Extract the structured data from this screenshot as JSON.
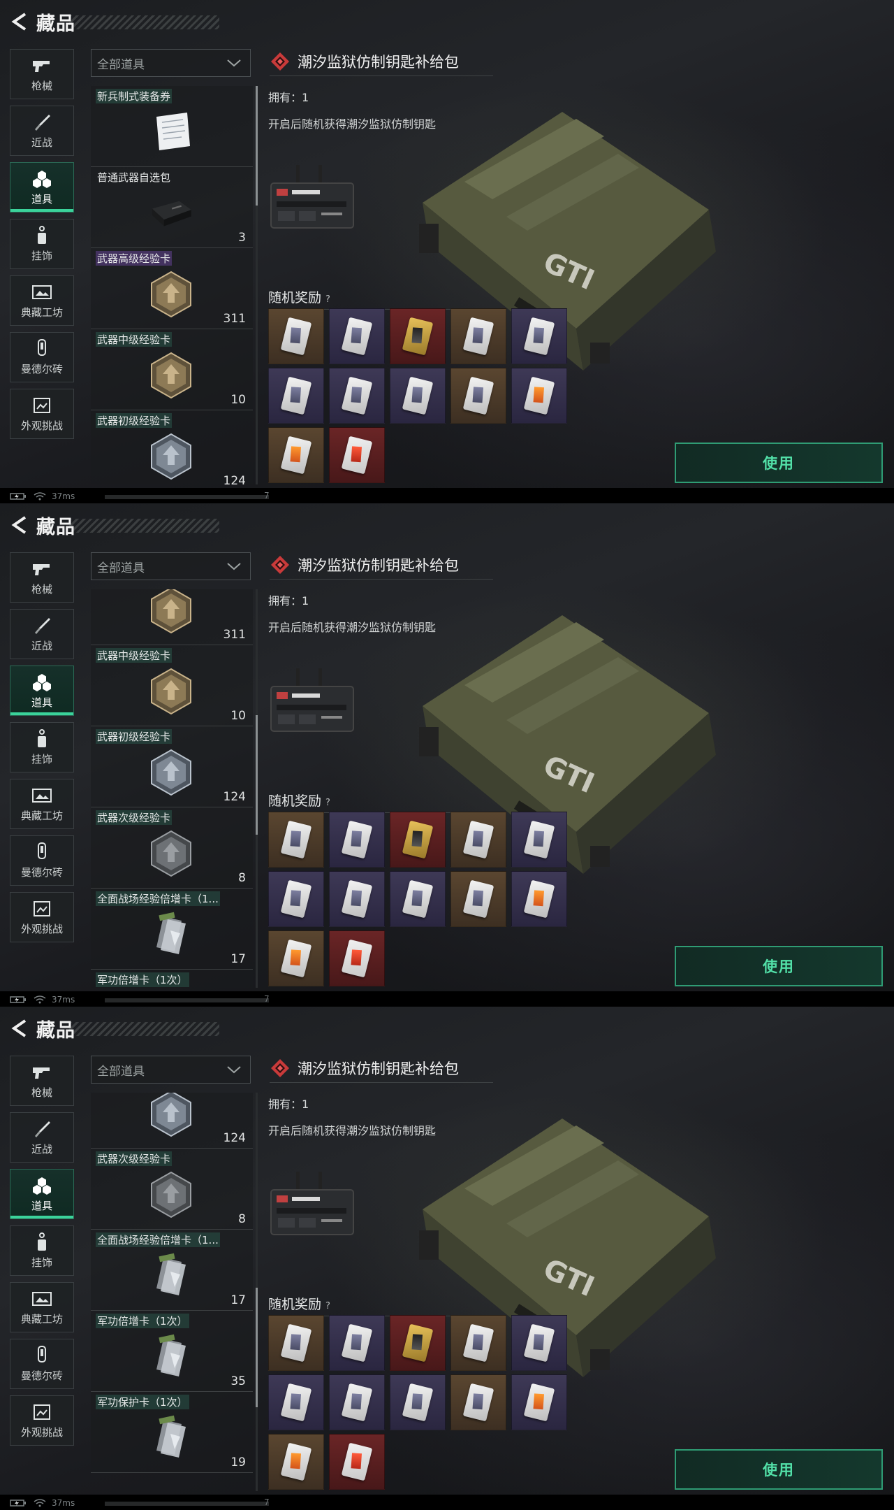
{
  "header": {
    "title": "藏品"
  },
  "nav": [
    {
      "label": "枪械",
      "icon": "gun-icon"
    },
    {
      "label": "近战",
      "icon": "knife-icon"
    },
    {
      "label": "道具",
      "icon": "items-icon",
      "active": true
    },
    {
      "label": "挂饰",
      "icon": "charm-icon"
    },
    {
      "label": "典藏工坊",
      "icon": "workshop-icon"
    },
    {
      "label": "曼德尔砖",
      "icon": "brick-icon"
    },
    {
      "label": "外观挑战",
      "icon": "challenge-icon"
    }
  ],
  "filter": {
    "selected": "全部道具"
  },
  "detail": {
    "name": "潮汐监狱仿制钥匙补给包",
    "owned": "拥有：1",
    "description": "开启后随机获得潮汐监狱仿制钥匙",
    "reward_header": "随机奖励",
    "reward_help": "?",
    "use_label": "使用"
  },
  "rewards": [
    {
      "bg": "brown",
      "card": "white"
    },
    {
      "bg": "purple",
      "card": "white"
    },
    {
      "bg": "red",
      "card": "gold"
    },
    {
      "bg": "brown",
      "card": "white"
    },
    {
      "bg": "purple",
      "card": "white"
    },
    {
      "bg": "purple",
      "card": "white"
    },
    {
      "bg": "purple",
      "card": "white"
    },
    {
      "bg": "purple",
      "card": "white"
    },
    {
      "bg": "brown",
      "card": "white"
    },
    {
      "bg": "purple",
      "card": "orange"
    },
    {
      "bg": "brown",
      "card": "orange"
    },
    {
      "bg": "red",
      "card": "red"
    }
  ],
  "status": {
    "ping": "37ms",
    "page": "7"
  },
  "panels": [
    {
      "items": [
        {
          "name": "新兵制式装备券",
          "count": "",
          "tag": "green",
          "img": "paper"
        },
        {
          "name": "普通武器自选包",
          "count": "3",
          "tag": "none",
          "img": "case"
        },
        {
          "name": "武器高级经验卡",
          "count": "311",
          "tag": "purple",
          "img": "hex-gold"
        },
        {
          "name": "武器中级经验卡",
          "count": "10",
          "tag": "green",
          "img": "hex-gold"
        },
        {
          "name": "武器初级经验卡",
          "count": "124",
          "tag": "green",
          "img": "hex-silver"
        }
      ],
      "offset": 0,
      "thumb": {
        "fraction_top": 0.0,
        "fraction_size": 0.3
      }
    },
    {
      "items": [
        {
          "name": "",
          "count": "311",
          "tag": "none",
          "img": "hex-gold"
        },
        {
          "name": "武器中级经验卡",
          "count": "10",
          "tag": "green",
          "img": "hex-gold"
        },
        {
          "name": "武器初级经验卡",
          "count": "124",
          "tag": "green",
          "img": "hex-silver"
        },
        {
          "name": "武器次级经验卡",
          "count": "8",
          "tag": "green",
          "img": "hex-gray"
        },
        {
          "name": "全面战场经验倍增卡（1...",
          "count": "17",
          "tag": "green",
          "img": "card-stack"
        },
        {
          "name": "军功倍增卡（1次）",
          "count": "",
          "tag": "green",
          "img": "card-stack"
        }
      ],
      "offset": 1,
      "thumb": {
        "fraction_top": 0.45,
        "fraction_size": 0.3
      }
    },
    {
      "items": [
        {
          "name": "",
          "count": "124",
          "tag": "none",
          "img": "hex-silver"
        },
        {
          "name": "武器次级经验卡",
          "count": "8",
          "tag": "green",
          "img": "hex-gray"
        },
        {
          "name": "全面战场经验倍增卡（1...",
          "count": "17",
          "tag": "green",
          "img": "card-stack"
        },
        {
          "name": "军功倍增卡（1次）",
          "count": "35",
          "tag": "green",
          "img": "card-stack"
        },
        {
          "name": "军功保护卡（1次）",
          "count": "19",
          "tag": "green",
          "img": "card-stack"
        }
      ],
      "offset": 2,
      "thumb": {
        "fraction_top": 0.7,
        "fraction_size": 0.3
      }
    }
  ]
}
